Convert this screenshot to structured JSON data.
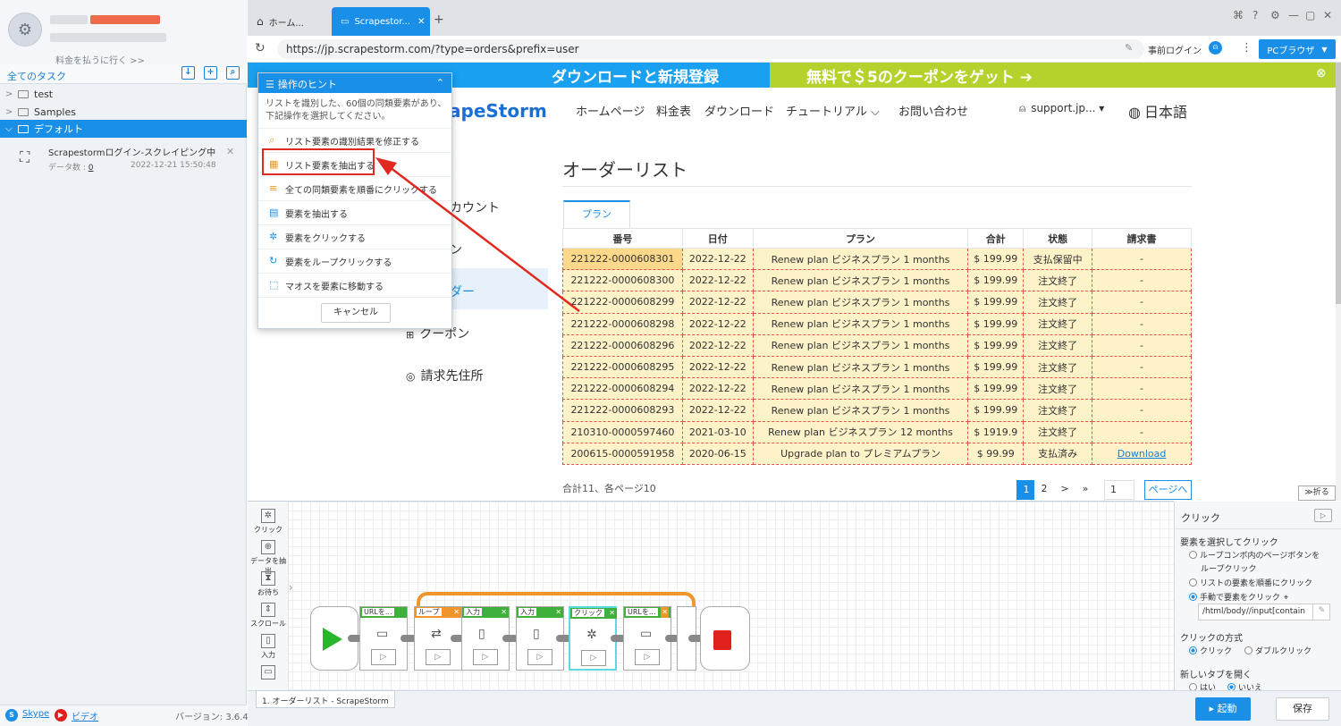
{
  "sidebar": {
    "pay_link": "料金を払うに行く >>",
    "all_tasks": "全てのタスク",
    "tree": [
      {
        "label": "test"
      },
      {
        "label": "Samples"
      },
      {
        "label": "デフォルト"
      }
    ],
    "task": {
      "name": "Scrapestormログイン-スクレイピング中",
      "count_label": "データ数 :",
      "count": "0",
      "date": "2022-12-21 15:50:48"
    },
    "footer": {
      "skype": "Skype",
      "video": "ビデオ",
      "version": "バージョン: 3.6.4"
    }
  },
  "browser": {
    "tabs": [
      {
        "label": "ホーム..."
      },
      {
        "label": "Scrapestor..."
      }
    ],
    "url": "https://jp.scrapestorm.com/?type=orders&prefix=user",
    "prelogin": "事前ログイン",
    "pc_browser": "PCブラウザ"
  },
  "site": {
    "banner_left": "ダウンロードと新規登録",
    "banner_right": "無料で＄5のクーポンをゲット ➔",
    "logo": "apeStorm",
    "nav": [
      "ホームページ",
      "料金表",
      "ダウンロード",
      "チュートリアル ⌵",
      "お問い合わせ"
    ],
    "user": "support.jp... ▾",
    "language": "日本語",
    "side_items": [
      "カウント",
      "ン",
      "ダー",
      "クーポン",
      "請求先住所"
    ],
    "title": "オーダーリスト",
    "plan_tab": "プラン",
    "table": {
      "headers": [
        "番号",
        "日付",
        "プラン",
        "合計",
        "状態",
        "請求書"
      ],
      "rows": [
        [
          "221222-0000608301",
          "2022-12-22",
          "Renew plan ビジネスプラン 1 months",
          "$ 199.99",
          "支払保留中",
          "-"
        ],
        [
          "221222-0000608300",
          "2022-12-22",
          "Renew plan ビジネスプラン 1 months",
          "$ 199.99",
          "注文終了",
          "-"
        ],
        [
          "221222-0000608299",
          "2022-12-22",
          "Renew plan ビジネスプラン 1 months",
          "$ 199.99",
          "注文終了",
          "-"
        ],
        [
          "221222-0000608298",
          "2022-12-22",
          "Renew plan ビジネスプラン 1 months",
          "$ 199.99",
          "注文終了",
          "-"
        ],
        [
          "221222-0000608296",
          "2022-12-22",
          "Renew plan ビジネスプラン 1 months",
          "$ 199.99",
          "注文終了",
          "-"
        ],
        [
          "221222-0000608295",
          "2022-12-22",
          "Renew plan ビジネスプラン 1 months",
          "$ 199.99",
          "注文終了",
          "-"
        ],
        [
          "221222-0000608294",
          "2022-12-22",
          "Renew plan ビジネスプラン 1 months",
          "$ 199.99",
          "注文終了",
          "-"
        ],
        [
          "221222-0000608293",
          "2022-12-22",
          "Renew plan ビジネスプラン 1 months",
          "$ 199.99",
          "注文終了",
          "-"
        ],
        [
          "210310-0000597460",
          "2021-03-10",
          "Renew plan ビジネスプラン 12 months",
          "$ 1919.9",
          "注文終了",
          "-"
        ],
        [
          "200615-0000591958",
          "2020-06-15",
          "Upgrade plan to プレミアムプラン",
          "$ 99.99",
          "支払済み",
          "Download"
        ]
      ]
    },
    "summary": "合計11、各ページ10",
    "pagination": {
      "p1": "1",
      "p2": "2",
      "next": ">",
      "last": "»",
      "input": "1",
      "goto": "ページへ"
    }
  },
  "hint": {
    "title": "操作のヒント",
    "desc": "リストを識別した、60個の同類要素があり、下記操作を選択してください。",
    "options": [
      "リスト要素の識別結果を修正する",
      "リスト要素を抽出する",
      "全ての同類要素を順番にクリックする",
      "要素を抽出する",
      "要素をクリックする",
      "要素をループクリックする",
      "マオスを要素に移動する"
    ],
    "cancel": "キャンセル"
  },
  "workflow": {
    "fold": "折る",
    "palette": [
      "クリック",
      "データを抽出",
      "お待ち",
      "スクロール",
      "入力"
    ],
    "nodes": [
      "URLを...",
      "ループ",
      "入力",
      "入力",
      "クリック",
      "URLを..."
    ],
    "caption": "1. オーダーリスト - ScrapeStorm"
  },
  "panel": {
    "title": "クリック",
    "select_label": "要素を選択してクリック",
    "opt1": "ループコンボ内のページボタンを",
    "opt1b": "ループクリック",
    "opt2": "リストの要素を順番にクリック",
    "opt3": "手動で要素をクリック",
    "xpath": "/html/body//input[contain",
    "method_label": "クリックの方式",
    "click": "クリック",
    "dblclick": "ダブルクリック",
    "newtab_label": "新しいタブを開く",
    "yes": "はい",
    "no": "いいえ"
  },
  "actions": {
    "start": "▸ 起動",
    "save": "保存"
  }
}
